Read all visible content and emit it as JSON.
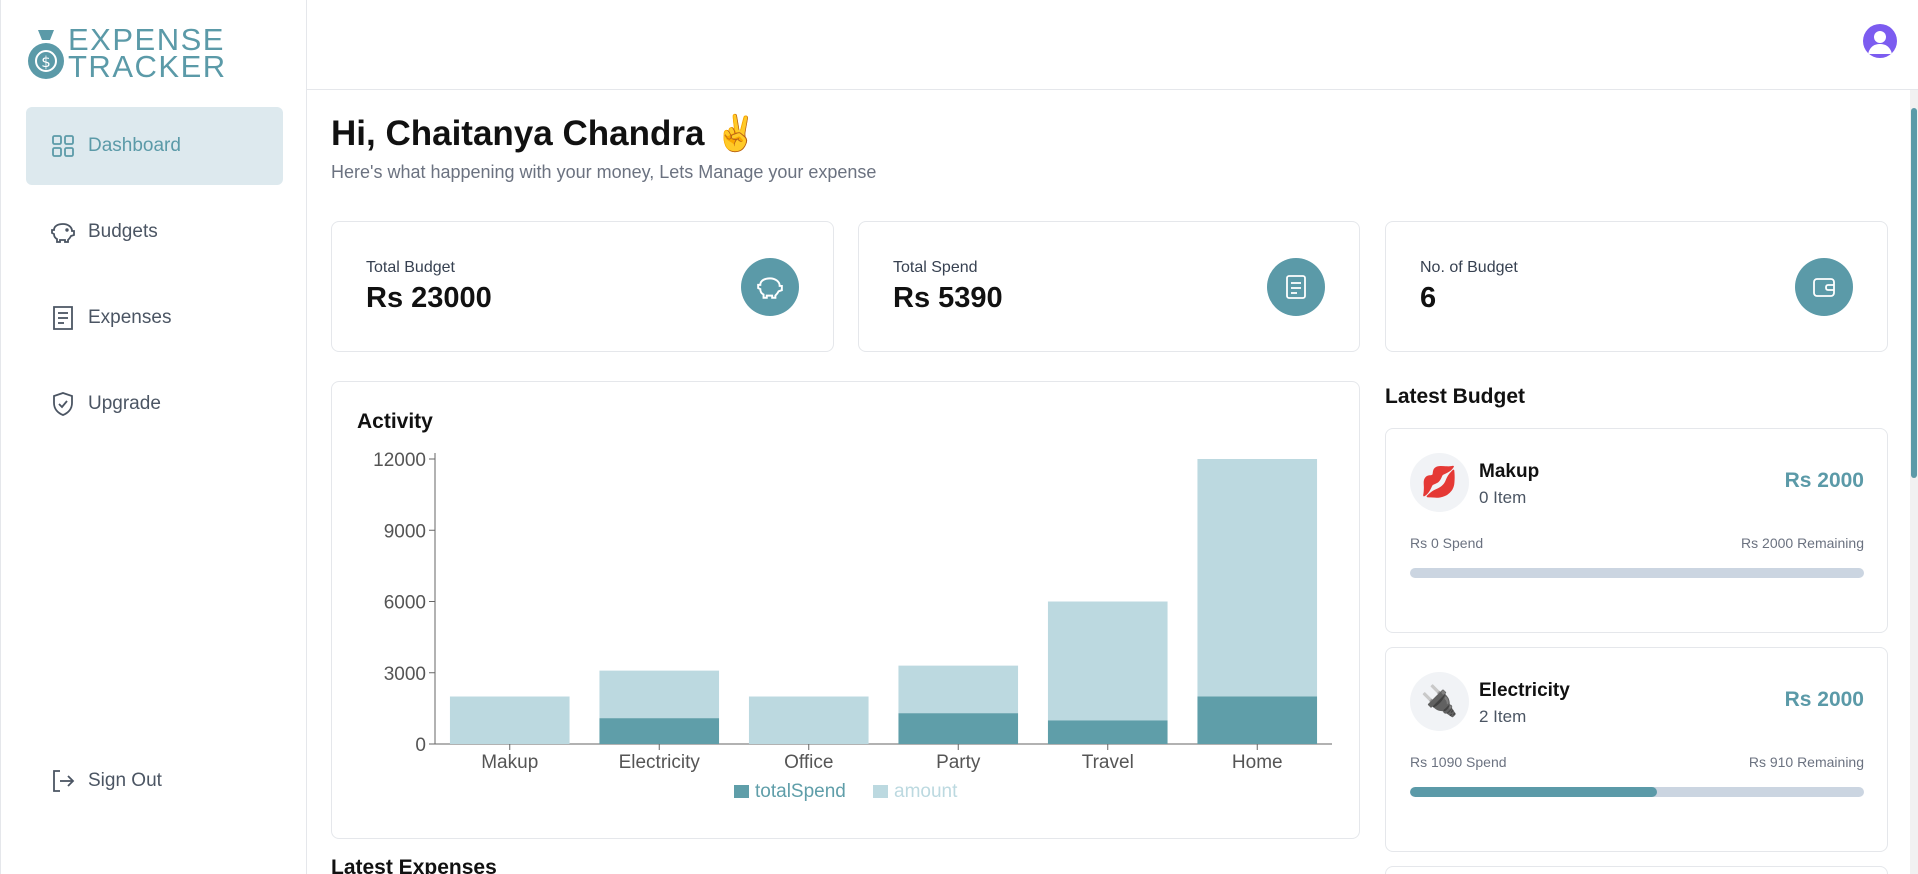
{
  "app": {
    "logo_line1": "EXPENSE",
    "logo_line2": "TRACKER",
    "brand_color": "#5b9aa8"
  },
  "sidebar": {
    "items": [
      {
        "label": "Dashboard",
        "icon": "layout-grid-icon",
        "active": true
      },
      {
        "label": "Budgets",
        "icon": "piggy-bank-icon",
        "active": false
      },
      {
        "label": "Expenses",
        "icon": "receipt-icon",
        "active": false
      },
      {
        "label": "Upgrade",
        "icon": "shield-check-icon",
        "active": false
      }
    ],
    "signout_label": "Sign Out"
  },
  "header": {
    "greeting": "Hi, Chaitanya Chandra ✌️",
    "subtitle": "Here's what happening with your money, Lets Manage your expense"
  },
  "stats": [
    {
      "label": "Total Budget",
      "value": "Rs 23000",
      "icon": "piggy-bank-icon"
    },
    {
      "label": "Total Spend",
      "value": "Rs 5390",
      "icon": "receipt-icon"
    },
    {
      "label": "No. of Budget",
      "value": "6",
      "icon": "wallet-icon"
    }
  ],
  "activity": {
    "title": "Activity"
  },
  "chart_data": {
    "type": "bar",
    "stacked": true,
    "categories": [
      "Makup",
      "Electricity",
      "Office",
      "Party",
      "Travel",
      "Home"
    ],
    "series": [
      {
        "name": "totalSpend",
        "values": [
          0,
          1090,
          0,
          1300,
          1000,
          2000
        ],
        "color": "#5f9ea9"
      },
      {
        "name": "amount",
        "values": [
          2000,
          2000,
          2000,
          2000,
          5000,
          10000
        ],
        "color": "#bcd9e0"
      }
    ],
    "yticks": [
      "0",
      "3000",
      "6000",
      "9000",
      "12000"
    ],
    "ylim": [
      0,
      12000
    ],
    "legend": "bottom-center",
    "grid": false
  },
  "latest_expenses": {
    "title": "Latest Expenses"
  },
  "latest_budget": {
    "title": "Latest Budget",
    "items": [
      {
        "emoji": "💋",
        "name": "Makup",
        "items": "0 Item",
        "amount": "Rs 2000",
        "spend": "Rs 0 Spend",
        "remaining": "Rs 2000 Remaining",
        "progress": 0
      },
      {
        "emoji": "🔌",
        "name": "Electricity",
        "items": "2 Item",
        "amount": "Rs 2000",
        "spend": "Rs 1090 Spend",
        "remaining": "Rs 910 Remaining",
        "progress": 0.545
      }
    ]
  }
}
